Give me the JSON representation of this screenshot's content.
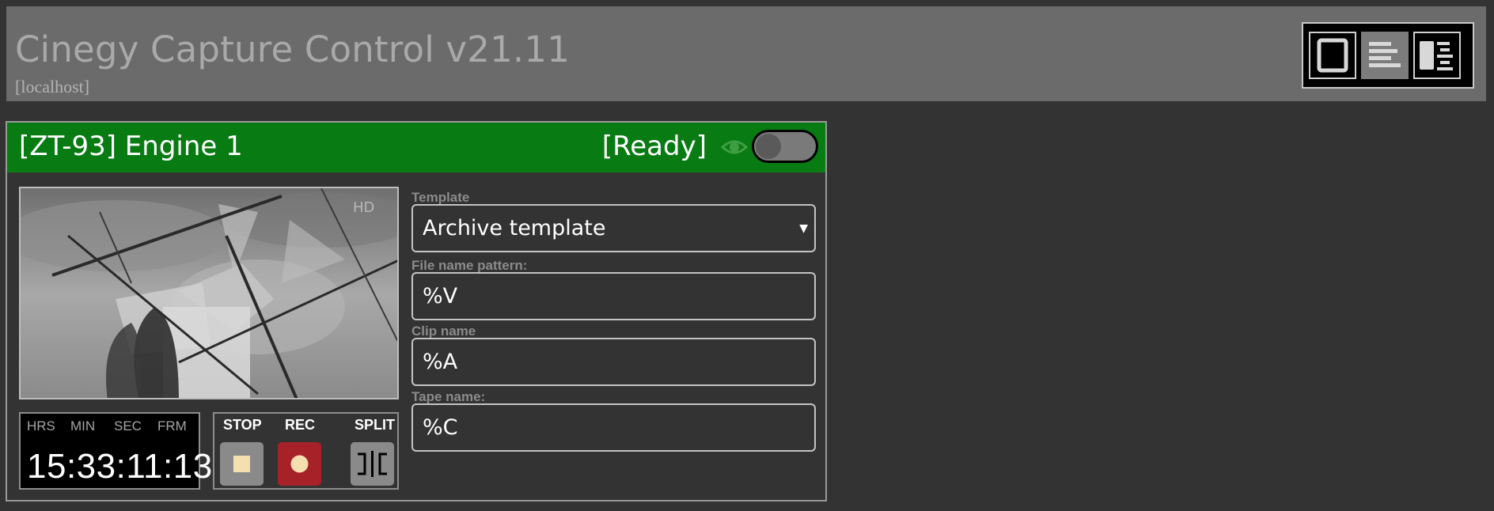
{
  "header": {
    "title": "Cinegy Capture Control v21.11",
    "host": "[localhost]",
    "background": "#6b6b6b",
    "view_buttons": [
      {
        "icon": "single-view-icon",
        "active": false
      },
      {
        "icon": "list-view-icon",
        "active": true
      },
      {
        "icon": "split-view-icon",
        "active": false
      }
    ]
  },
  "engine": {
    "title": "[ZT-93] Engine 1",
    "status": "[Ready]",
    "header_color": "#087b13",
    "preview_toggle": "off",
    "timecode": {
      "labels": [
        "HRS",
        "MIN",
        "SEC",
        "FRM"
      ],
      "value": "15:33:11:13"
    },
    "transport": {
      "stop_label": "STOP",
      "rec_label": "REC",
      "split_label": "SPLIT",
      "rec_color": "#a72228"
    },
    "fields": {
      "template_label": "Template",
      "template_value": "Archive template",
      "file_name_label": "File name pattern:",
      "file_name_value": "%V",
      "clip_name_label": "Clip name",
      "clip_name_value": "%A",
      "tape_name_label": "Tape name:",
      "tape_name_value": "%C"
    }
  }
}
